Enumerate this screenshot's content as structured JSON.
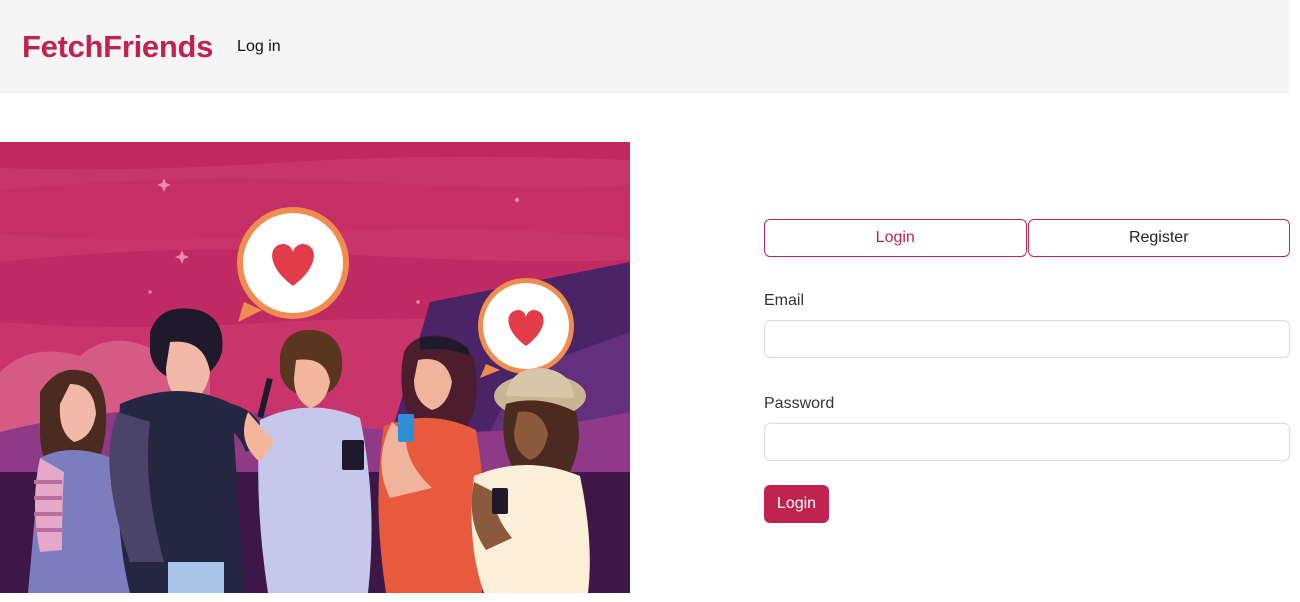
{
  "navbar": {
    "brand": "FetchFriends",
    "login_link": "Log in"
  },
  "hero": {
    "icons": [
      "heart-icon",
      "heart-icon"
    ]
  },
  "auth": {
    "tabs": [
      {
        "label": "Login",
        "active": true
      },
      {
        "label": "Register",
        "active": false
      }
    ],
    "email": {
      "label": "Email",
      "value": "",
      "placeholder": ""
    },
    "password": {
      "label": "Password",
      "value": "",
      "placeholder": ""
    },
    "submit_label": "Login"
  },
  "colors": {
    "brand": "#c1234f",
    "navbar_bg": "#f5f5f5"
  }
}
